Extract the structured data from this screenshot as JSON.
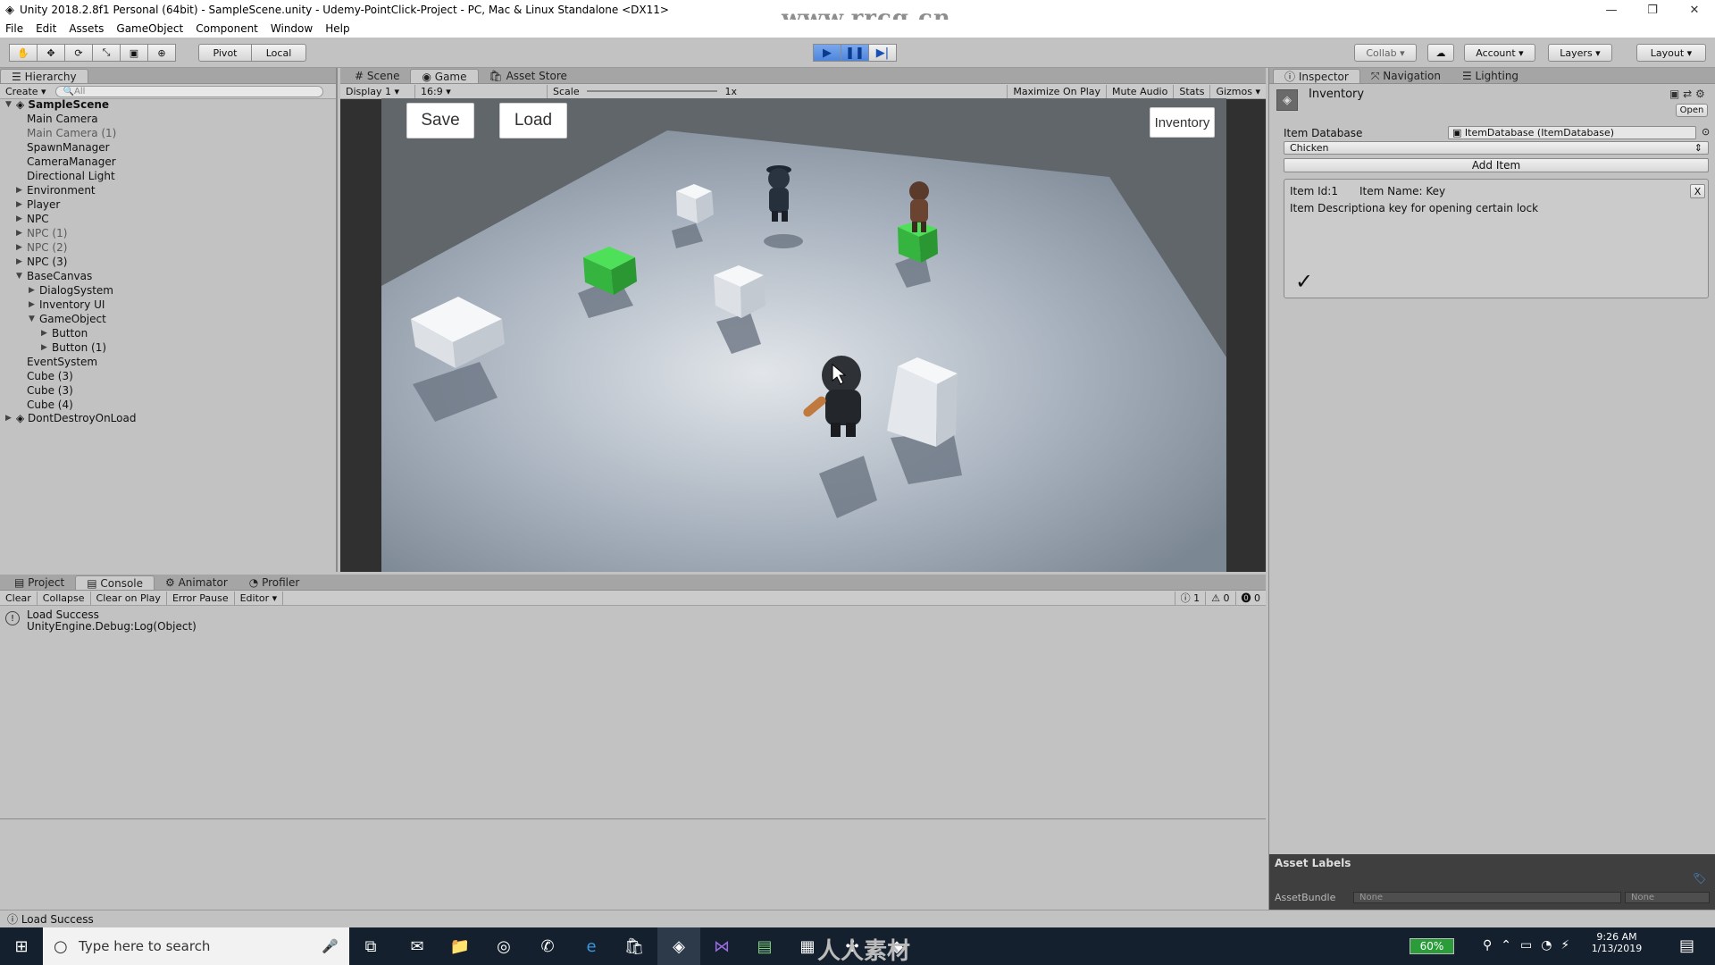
{
  "window": {
    "title": "Unity 2018.2.8f1 Personal (64bit) - SampleScene.unity - Udemy-PointClick-Project - PC, Mac & Linux Standalone <DX11>",
    "watermark": "www.rrcg.cn",
    "controls": {
      "minimize": "—",
      "maximize": "❐",
      "close": "✕"
    }
  },
  "menu": [
    "File",
    "Edit",
    "Assets",
    "GameObject",
    "Component",
    "Window",
    "Help"
  ],
  "toolbar": {
    "pivot": "Pivot",
    "local": "Local",
    "collab": "Collab",
    "account": "Account",
    "layers": "Layers",
    "layout": "Layout",
    "play_icon": "▶",
    "pause_icon": "❚❚",
    "step_icon": "▶|"
  },
  "hierarchy": {
    "tab": "Hierarchy",
    "create": "Create",
    "search_placeholder": "All",
    "scene": "SampleScene",
    "items": [
      {
        "label": "Main Camera",
        "indent": 1,
        "dim": false,
        "arrow": ""
      },
      {
        "label": "Main Camera (1)",
        "indent": 1,
        "dim": true,
        "arrow": ""
      },
      {
        "label": "SpawnManager",
        "indent": 1,
        "dim": false,
        "arrow": ""
      },
      {
        "label": "CameraManager",
        "indent": 1,
        "dim": false,
        "arrow": ""
      },
      {
        "label": "Directional Light",
        "indent": 1,
        "dim": false,
        "arrow": ""
      },
      {
        "label": "Environment",
        "indent": 1,
        "dim": false,
        "arrow": "▶"
      },
      {
        "label": "Player",
        "indent": 1,
        "dim": false,
        "arrow": "▶"
      },
      {
        "label": "NPC",
        "indent": 1,
        "dim": false,
        "arrow": "▶"
      },
      {
        "label": "NPC (1)",
        "indent": 1,
        "dim": true,
        "arrow": "▶"
      },
      {
        "label": "NPC (2)",
        "indent": 1,
        "dim": true,
        "arrow": "▶"
      },
      {
        "label": "NPC (3)",
        "indent": 1,
        "dim": false,
        "arrow": "▶"
      },
      {
        "label": "BaseCanvas",
        "indent": 1,
        "dim": false,
        "arrow": "▼"
      },
      {
        "label": "DialogSystem",
        "indent": 2,
        "dim": false,
        "arrow": "▶"
      },
      {
        "label": "Inventory UI",
        "indent": 2,
        "dim": false,
        "arrow": "▶"
      },
      {
        "label": "GameObject",
        "indent": 2,
        "dim": false,
        "arrow": "▼"
      },
      {
        "label": "Button",
        "indent": 3,
        "dim": false,
        "arrow": "▶"
      },
      {
        "label": "Button (1)",
        "indent": 3,
        "dim": false,
        "arrow": "▶"
      },
      {
        "label": "EventSystem",
        "indent": 1,
        "dim": false,
        "arrow": ""
      },
      {
        "label": "Cube (3)",
        "indent": 1,
        "dim": false,
        "arrow": ""
      },
      {
        "label": "Cube (3)",
        "indent": 1,
        "dim": false,
        "arrow": ""
      },
      {
        "label": "Cube (4)",
        "indent": 1,
        "dim": false,
        "arrow": ""
      }
    ],
    "dont_destroy": "DontDestroyOnLoad"
  },
  "game_tabs": [
    "Scene",
    "Game",
    "Asset Store"
  ],
  "game_bar": {
    "display": "Display 1",
    "aspect": "16:9",
    "scale_label": "Scale",
    "scale_value": "1x",
    "maximize": "Maximize On Play",
    "mute": "Mute Audio",
    "stats": "Stats",
    "gizmos": "Gizmos"
  },
  "game_ui": {
    "save": "Save",
    "load": "Load",
    "inventory": "Inventory"
  },
  "inspector": {
    "tabs": [
      "Inspector",
      "Navigation",
      "Lighting"
    ],
    "object_name": "Inventory",
    "open": "Open",
    "item_database_label": "Item Database",
    "item_database_value": "ItemDatabase (ItemDatabase)",
    "dropdown_value": "Chicken",
    "add_item": "Add Item",
    "item_id": "Item Id:1",
    "item_name": "Item Name: Key",
    "item_description": "Item Descriptiona key for opening certain lock",
    "remove": "X",
    "check": "✓",
    "asset_labels": "Asset Labels",
    "assetbundle_label": "AssetBundle",
    "assetbundle_value": "None",
    "assetbundle_variant": "None"
  },
  "console": {
    "tabs": [
      "Project",
      "Console",
      "Animator",
      "Profiler"
    ],
    "buttons": [
      "Clear",
      "Collapse",
      "Clear on Play",
      "Error Pause",
      "Editor"
    ],
    "counts": {
      "log": "1",
      "warn": "0",
      "error": "0"
    },
    "entry_line1": "Load Success",
    "entry_line2": "UnityEngine.Debug:Log(Object)"
  },
  "status": "Load Success",
  "taskbar": {
    "search_placeholder": "Type here to search",
    "battery": "60%",
    "time": "9:26 AM",
    "date": "1/13/2019",
    "watermark": "人人素材"
  }
}
